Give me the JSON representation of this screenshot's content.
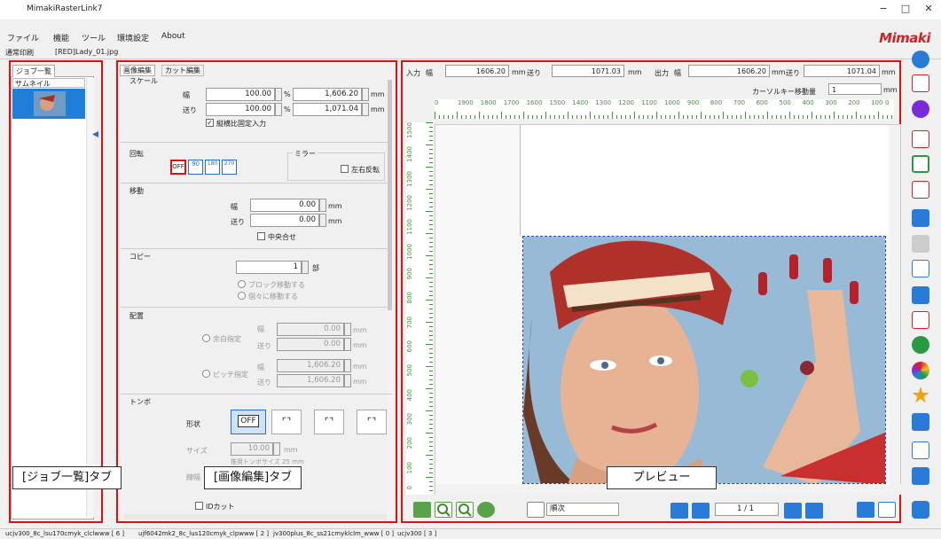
{
  "app": {
    "title": "MimakiRasterLink7",
    "logo": "Mimaki",
    "win_min": "−",
    "win_max": "□",
    "win_close": "✕"
  },
  "menu": [
    "ファイル",
    "機能",
    "ツール",
    "環境設定",
    "About"
  ],
  "print_mode": "通常印刷",
  "file_tag": "[RED]Lady_01.jpg",
  "job_list": {
    "tab": "ジョブ一覧",
    "col": "サムネイル"
  },
  "editor": {
    "tab_edit": "画像編集",
    "tab_cut": "カット編集",
    "scale": {
      "title": "スケール",
      "width_label": "幅",
      "feed_label": "送り",
      "w_pct": "100.00",
      "w_mm": "1,606.20",
      "f_pct": "100.00",
      "f_mm": "1,071.04",
      "pct": "%",
      "mm": "mm",
      "lock": "縦横比固定入力"
    },
    "rotate": {
      "title": "回転",
      "off": "OFF",
      "r90": "90",
      "r180": "180",
      "r270": "270"
    },
    "mirror": {
      "title": "ミラー",
      "lr": "左右反転"
    },
    "move": {
      "title": "移動",
      "w": "幅",
      "f": "送り",
      "w_val": "0.00",
      "f_val": "0.00",
      "mm": "mm",
      "center": "中央合せ"
    },
    "copy": {
      "title": "コピー",
      "val": "1",
      "unit": "部",
      "block": "ブロック移動する",
      "each": "個々に移動する"
    },
    "layout": {
      "title": "配置",
      "margin": "余白指定",
      "pitch": "ピッチ指定",
      "w": "幅",
      "f": "送り",
      "m_w": "0.00",
      "m_f": "0.00",
      "p_w": "1,606.20",
      "p_f": "1,606.20",
      "mm": "mm"
    },
    "tombo": {
      "title": "トンボ",
      "shape": "形状",
      "off": "OFF",
      "size": "サイズ",
      "size_val": "10.00",
      "mm": "mm",
      "rec": "推奨トンボサイズ 25 mm",
      "line": "線幅",
      "id": "IDカット"
    }
  },
  "preview": {
    "in_label": "入力",
    "w": "幅",
    "in_w": "1606.20",
    "mm": "mm",
    "feed": "送り",
    "in_f": "1071.03",
    "out_label": "出力",
    "out_w": "1606.20",
    "out_f": "1071.04",
    "cursor": "カーソルキー移動量",
    "cursor_val": "1",
    "ruler_top": [
      "0",
      "1900",
      "1800",
      "1700",
      "1600",
      "1500",
      "1400",
      "1300",
      "1200",
      "1100",
      "1000",
      "900",
      "800",
      "700",
      "600",
      "500",
      "400",
      "300",
      "200",
      "100",
      "0"
    ],
    "ruler_left": [
      "1500",
      "1400",
      "1300",
      "1200",
      "1100",
      "1000",
      "900",
      "800",
      "700",
      "600",
      "500",
      "400",
      "300",
      "200",
      "100",
      "0"
    ],
    "order": "順次",
    "page": "1 / 1"
  },
  "status": [
    "ucjv300_8c_lsu170cmyk_clclwww [ 6 ]",
    "ujf6042mk2_8c_lus120cmyk_clpwww [ 2 ]",
    "jv300plus_8c_ss21cmyklclm_www [ 0 ]",
    "ucjv300 [ 3 ]"
  ],
  "callouts": {
    "job": "[ジョブ一覧]タブ",
    "edit": "[画像編集]タブ",
    "preview": "プレビュー"
  }
}
